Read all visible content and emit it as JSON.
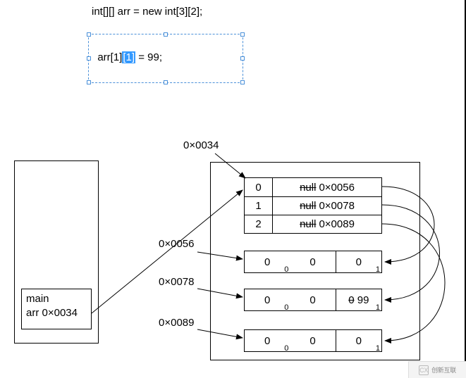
{
  "code": {
    "declaration": "int[][] arr = new int[3][2];",
    "assignment_prefix": "arr[1]",
    "assignment_highlight": "[1]",
    "assignment_suffix": " = 99;"
  },
  "stack": {
    "frame_name": "main",
    "var_name": "arr",
    "var_value": "0×0034"
  },
  "heap": {
    "outer_address": "0×0034",
    "outer_rows": [
      {
        "index": "0",
        "old": "null",
        "addr": "0×0056"
      },
      {
        "index": "1",
        "old": "null",
        "addr": "0×0078"
      },
      {
        "index": "2",
        "old": "null",
        "addr": "0×0089"
      }
    ],
    "subarrays": [
      {
        "address_label": "0×0056",
        "cells": [
          "0",
          "0",
          "0"
        ],
        "idx0": "0",
        "idx1": "1",
        "strike_last": false,
        "extra": ""
      },
      {
        "address_label": "0×0078",
        "cells": [
          "0",
          "0",
          "0 99"
        ],
        "idx0": "0",
        "idx1": "1",
        "strike_last": true,
        "extra": ""
      },
      {
        "address_label": "0×0089",
        "cells": [
          "0",
          "0",
          "0"
        ],
        "idx0": "0",
        "idx1": "1",
        "strike_last": false,
        "extra": ""
      }
    ]
  },
  "watermark": {
    "logo": "CX",
    "text": "创新互联"
  }
}
